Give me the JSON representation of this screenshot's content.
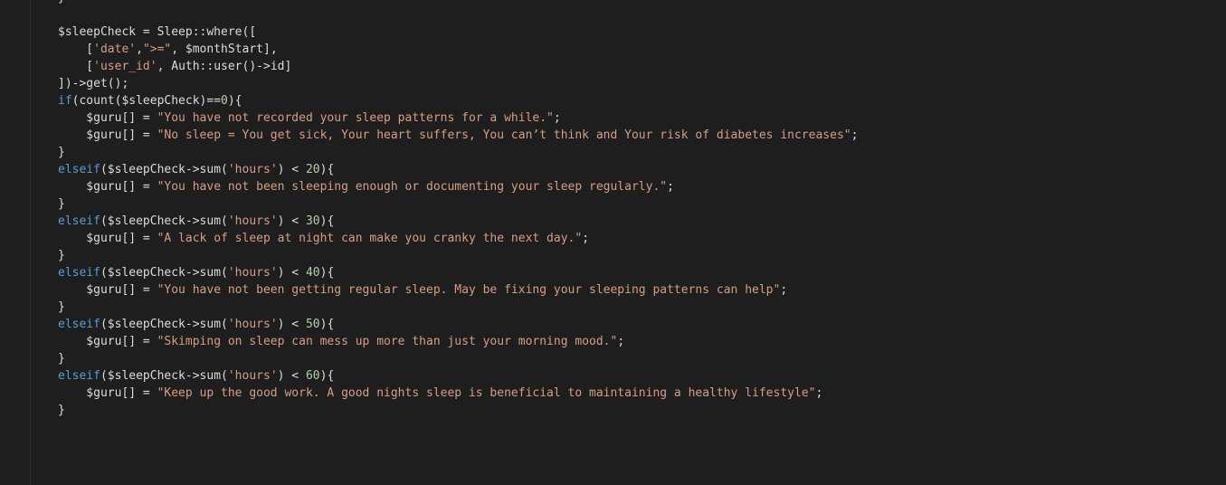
{
  "theme": {
    "background": "#1e1e1e",
    "plain": "#dcdcdc",
    "keyword": "#569cd6",
    "string": "#d69d85",
    "number": "#b5cea8"
  },
  "code_lines": [
    [
      {
        "t": "}",
        "c": "plain"
      }
    ],
    [],
    [
      {
        "t": "$sleepCheck = Sleep::where([",
        "c": "plain"
      }
    ],
    [
      {
        "t": "    [",
        "c": "plain"
      },
      {
        "t": "'date'",
        "c": "str"
      },
      {
        "t": ",",
        "c": "plain"
      },
      {
        "t": "\">=\"",
        "c": "str"
      },
      {
        "t": ", $monthStart],",
        "c": "plain"
      }
    ],
    [
      {
        "t": "    [",
        "c": "plain"
      },
      {
        "t": "'user_id'",
        "c": "str"
      },
      {
        "t": ", Auth::user()->id]",
        "c": "plain"
      }
    ],
    [
      {
        "t": "])->get();",
        "c": "plain"
      }
    ],
    [
      {
        "t": "if",
        "c": "kw"
      },
      {
        "t": "(count($sleepCheck)==",
        "c": "plain"
      },
      {
        "t": "0",
        "c": "num"
      },
      {
        "t": "){",
        "c": "plain"
      }
    ],
    [
      {
        "t": "    $guru[] = ",
        "c": "plain"
      },
      {
        "t": "\"You have not recorded your sleep patterns for a while.\"",
        "c": "str"
      },
      {
        "t": ";",
        "c": "plain"
      }
    ],
    [
      {
        "t": "    $guru[] = ",
        "c": "plain"
      },
      {
        "t": "\"No sleep = You get sick, Your heart suffers, You can’t think and Your risk of diabetes increases\"",
        "c": "str"
      },
      {
        "t": ";",
        "c": "plain"
      }
    ],
    [
      {
        "t": "}",
        "c": "plain"
      }
    ],
    [
      {
        "t": "elseif",
        "c": "kw"
      },
      {
        "t": "($sleepCheck->sum(",
        "c": "plain"
      },
      {
        "t": "'hours'",
        "c": "str"
      },
      {
        "t": ") < ",
        "c": "plain"
      },
      {
        "t": "20",
        "c": "num"
      },
      {
        "t": "){",
        "c": "plain"
      }
    ],
    [
      {
        "t": "    $guru[] = ",
        "c": "plain"
      },
      {
        "t": "\"You have not been sleeping enough or documenting your sleep regularly.\"",
        "c": "str"
      },
      {
        "t": ";",
        "c": "plain"
      }
    ],
    [
      {
        "t": "}",
        "c": "plain"
      }
    ],
    [
      {
        "t": "elseif",
        "c": "kw"
      },
      {
        "t": "($sleepCheck->sum(",
        "c": "plain"
      },
      {
        "t": "'hours'",
        "c": "str"
      },
      {
        "t": ") < ",
        "c": "plain"
      },
      {
        "t": "30",
        "c": "num"
      },
      {
        "t": "){",
        "c": "plain"
      }
    ],
    [
      {
        "t": "    $guru[] = ",
        "c": "plain"
      },
      {
        "t": "\"A lack of sleep at night can make you cranky the next day.\"",
        "c": "str"
      },
      {
        "t": ";",
        "c": "plain"
      }
    ],
    [
      {
        "t": "}",
        "c": "plain"
      }
    ],
    [
      {
        "t": "elseif",
        "c": "kw"
      },
      {
        "t": "($sleepCheck->sum(",
        "c": "plain"
      },
      {
        "t": "'hours'",
        "c": "str"
      },
      {
        "t": ") < ",
        "c": "plain"
      },
      {
        "t": "40",
        "c": "num"
      },
      {
        "t": "){",
        "c": "plain"
      }
    ],
    [
      {
        "t": "    $guru[] = ",
        "c": "plain"
      },
      {
        "t": "\"You have not been getting regular sleep. May be fixing your sleeping patterns can help\"",
        "c": "str"
      },
      {
        "t": ";",
        "c": "plain"
      }
    ],
    [
      {
        "t": "}",
        "c": "plain"
      }
    ],
    [
      {
        "t": "elseif",
        "c": "kw"
      },
      {
        "t": "($sleepCheck->sum(",
        "c": "plain"
      },
      {
        "t": "'hours'",
        "c": "str"
      },
      {
        "t": ") < ",
        "c": "plain"
      },
      {
        "t": "50",
        "c": "num"
      },
      {
        "t": "){",
        "c": "plain"
      }
    ],
    [
      {
        "t": "    $guru[] = ",
        "c": "plain"
      },
      {
        "t": "\"Skimping on sleep can mess up more than just your morning mood.\"",
        "c": "str"
      },
      {
        "t": ";",
        "c": "plain"
      }
    ],
    [
      {
        "t": "}",
        "c": "plain"
      }
    ],
    [
      {
        "t": "elseif",
        "c": "kw"
      },
      {
        "t": "($sleepCheck->sum(",
        "c": "plain"
      },
      {
        "t": "'hours'",
        "c": "str"
      },
      {
        "t": ") < ",
        "c": "plain"
      },
      {
        "t": "60",
        "c": "num"
      },
      {
        "t": "){",
        "c": "plain"
      }
    ],
    [
      {
        "t": "    $guru[] = ",
        "c": "plain"
      },
      {
        "t": "\"Keep up the good work. A good nights sleep is beneficial to maintaining a healthy lifestyle\"",
        "c": "str"
      },
      {
        "t": ";",
        "c": "plain"
      }
    ],
    [
      {
        "t": "}",
        "c": "plain"
      }
    ]
  ]
}
